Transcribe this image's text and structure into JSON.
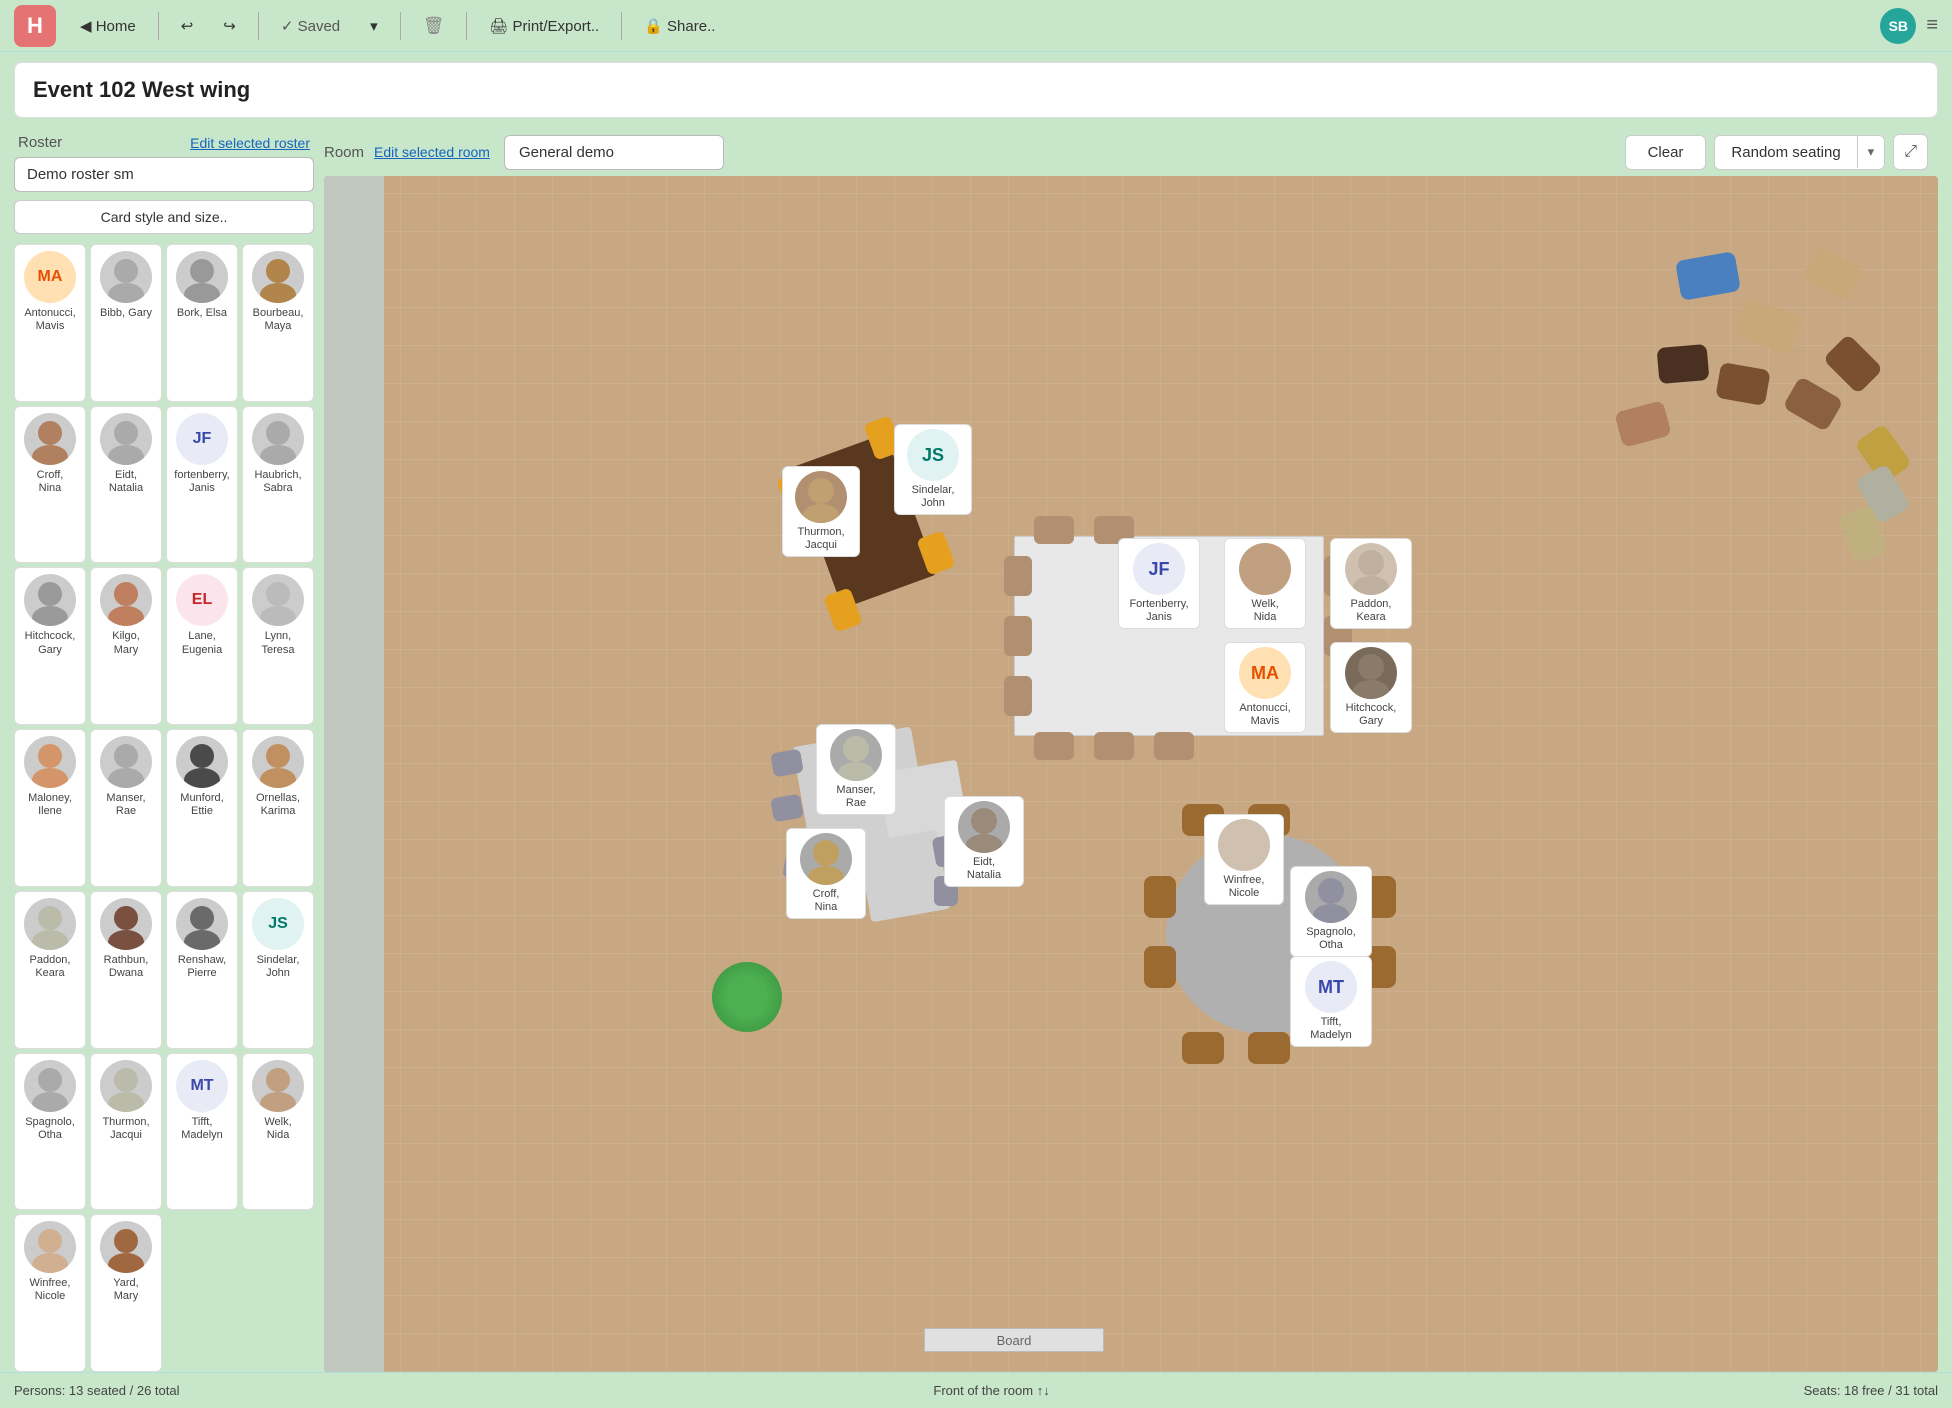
{
  "app": {
    "logo": "H",
    "title": "Event 102 West wing"
  },
  "nav": {
    "home": "◀  Home",
    "undo": "↩",
    "redo": "↪",
    "saved": "✓  Saved",
    "saved_caret": "▾",
    "delete": "🗑",
    "print": "🖨  Print/Export..",
    "share": "🔒  Share..",
    "user_initials": "SB",
    "menu": "≡"
  },
  "roster": {
    "label": "Roster",
    "edit_link": "Edit selected roster",
    "selected": "Demo roster sm",
    "card_style_btn": "Card style and size..",
    "persons_status": "Persons: 13 seated / 26 total"
  },
  "room": {
    "label": "Room",
    "edit_link": "Edit selected room",
    "selected": "General demo",
    "clear_btn": "Clear",
    "random_btn": "Random seating",
    "seats_status": "Seats: 18 free / 31 total",
    "front_label": "Front of the room ↑↓"
  },
  "people": [
    {
      "id": "antonucci_mavis",
      "initials": "MA",
      "name": "Antonucci,\nMavis",
      "has_photo": false,
      "color_class": "color-ma"
    },
    {
      "id": "bibb_gary",
      "initials": "",
      "name": "Bibb, Gary",
      "has_photo": true
    },
    {
      "id": "bork_elsa",
      "initials": "",
      "name": "Bork, Elsa",
      "has_photo": true
    },
    {
      "id": "bourbeau_maya",
      "initials": "",
      "name": "Bourbeau,\nMaya",
      "has_photo": true
    },
    {
      "id": "croff_nina",
      "initials": "",
      "name": "Croff,\nNina",
      "has_photo": true
    },
    {
      "id": "eidt_natalia",
      "initials": "",
      "name": "Eidt,\nNatalia",
      "has_photo": true
    },
    {
      "id": "fortenberry_janis",
      "initials": "JF",
      "name": "Fortenberry\nJanis",
      "has_photo": false,
      "color_class": "color-jf"
    },
    {
      "id": "haubrich_sabra",
      "initials": "",
      "name": "Haubrich,\nSabra",
      "has_photo": true
    },
    {
      "id": "hitchcock_gary",
      "initials": "",
      "name": "Hitchcock,\nGary",
      "has_photo": true
    },
    {
      "id": "kilgo_mary",
      "initials": "",
      "name": "Kilgo,\nMary",
      "has_photo": true
    },
    {
      "id": "lane_eugenia",
      "initials": "EL",
      "name": "Lane,\nEugenia",
      "has_photo": false,
      "color_class": "color-el"
    },
    {
      "id": "lynn_teresa",
      "initials": "",
      "name": "Lynn,\nTeresa",
      "has_photo": true
    },
    {
      "id": "maloney_ilene",
      "initials": "",
      "name": "Maloney,\nIlene",
      "has_photo": true
    },
    {
      "id": "manser_rae",
      "initials": "",
      "name": "Manser,\nRae",
      "has_photo": true
    },
    {
      "id": "munford_ettie",
      "initials": "",
      "name": "Munford,\nEttie",
      "has_photo": true
    },
    {
      "id": "ornellas_karima",
      "initials": "",
      "name": "Ornellas,\nKarima",
      "has_photo": true
    },
    {
      "id": "paddon_keara",
      "initials": "",
      "name": "Paddon,\nKeara",
      "has_photo": true
    },
    {
      "id": "rathbun_dwana",
      "initials": "",
      "name": "Rathbun,\nDwana",
      "has_photo": true
    },
    {
      "id": "renshaw_pierre",
      "initials": "",
      "name": "Renshaw,\nPierre",
      "has_photo": true
    },
    {
      "id": "sindelar_john",
      "initials": "JS",
      "name": "Sindelar,\nJohn",
      "has_photo": false,
      "color_class": "color-js"
    },
    {
      "id": "spagnolo_otha",
      "initials": "",
      "name": "Spagnolo,\nOtha",
      "has_photo": true
    },
    {
      "id": "thurmon_jacqui",
      "initials": "",
      "name": "Thurmon,\nJacqui",
      "has_photo": true
    },
    {
      "id": "tifft_madelyn",
      "initials": "MT",
      "name": "Tifft,\nMadelyn",
      "has_photo": false,
      "color_class": "color-mt"
    },
    {
      "id": "welk_nida",
      "initials": "",
      "name": "Welk,\nNida",
      "has_photo": true
    },
    {
      "id": "winfree_nicole",
      "initials": "",
      "name": "Winfree,\nNicole",
      "has_photo": true
    },
    {
      "id": "yard_mary",
      "initials": "",
      "name": "Yard,\nMary",
      "has_photo": true
    }
  ]
}
